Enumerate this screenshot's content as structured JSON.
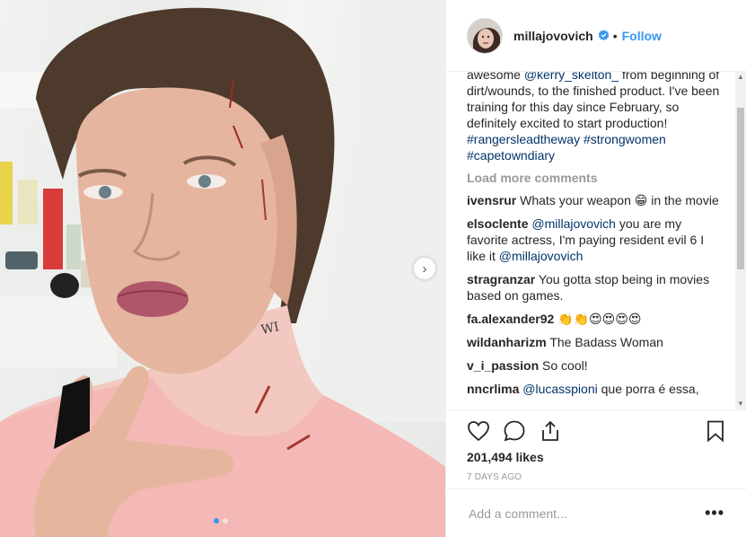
{
  "post": {
    "username": "millajovovich",
    "follow_label": "Follow",
    "separator": "•"
  },
  "caption": {
    "partial_line": "awesome ",
    "mention": "@kerry_skelton_",
    "text": " from beginning of dirt/wounds, to the finished product. I've been training for this day since February, so definitely excited to start production!",
    "hashtags": "#rangersleadtheway #strongwomen #capetowndiary"
  },
  "load_more_label": "Load more comments",
  "comments": [
    {
      "user": "ivensrur",
      "text": "Whats your weapon 😁 in the movie"
    },
    {
      "user": "elsoclente",
      "mention": "@millajovovich",
      "text": " you are my favorite actress, I'm paying resident evil 6 I like it ",
      "mention2": "@millajovovich"
    },
    {
      "user": "stragranzar",
      "text": "You gotta stop being in movies based on games."
    },
    {
      "user": "fa.alexander92",
      "text": "👏👏😍😍😍😍"
    },
    {
      "user": "wildanharizm",
      "text": "The Badass Woman"
    },
    {
      "user": "v_i_passion",
      "text": "So cool!"
    },
    {
      "user": "nncrlima",
      "mention": "@lucasspioni",
      "text": " que porra é essa,"
    }
  ],
  "actions": {
    "likes": "201,494 likes",
    "time_ago": "7 DAYS AGO"
  },
  "add_comment": {
    "placeholder": "Add a comment..."
  },
  "more_label": "•••",
  "icons": {
    "like": "heart-icon",
    "comment": "comment-icon",
    "share": "share-icon",
    "save": "bookmark-icon",
    "verified": "verified-badge-icon",
    "next": "chevron-right-icon"
  },
  "colors": {
    "accent": "#3897f0",
    "link": "#003569",
    "muted": "#999999",
    "text": "#262626"
  },
  "carousel": {
    "count": 2,
    "active": 1
  }
}
